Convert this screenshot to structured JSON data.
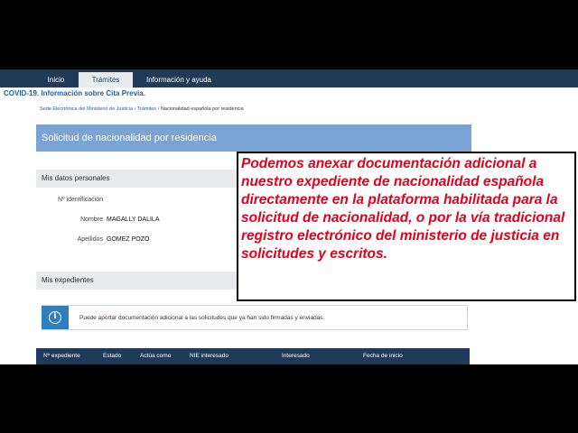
{
  "nav": {
    "items": [
      {
        "label": "Inicio"
      },
      {
        "label": "Trámites"
      },
      {
        "label": "Información y ayuda"
      }
    ]
  },
  "covid_banner": "COVID-19. Información sobre Cita Previa.",
  "breadcrumb": {
    "root": "Sede Electrónica del Ministerio de Justicia",
    "sep": "›",
    "tramites": "Trámites",
    "current": "Nacionalidad española por residencia"
  },
  "page_title": "Solicitud de nacionalidad por residencia",
  "personal": {
    "header": "Mis datos personales",
    "id_label": "Nº identificación",
    "id_value": "",
    "name_label": "Nombre",
    "name_value": "MAGALLY DALILA",
    "surname_label": "Apellidos",
    "surname_value": "GOMEZ POZO"
  },
  "expedientes": {
    "header": "Mis expedientes",
    "info_text": "Puede aportar documentación adicional a las solicitudes que ya han sido firmadas y enviadas.",
    "columns": [
      "Nº expediente",
      "Estado",
      "Actúa como",
      "NIE interesado",
      "Interesado",
      "Fecha de inicio"
    ]
  },
  "overlay": {
    "text": "Podemos anexar documentación adicional a nuestro expediente de nacionalidad española directamente en la plataforma habilitada para la solicitud de nacionalidad, o por la vía tradicional registro electrónico del ministerio de justicia en solicitudes y escritos."
  },
  "colors": {
    "nav_bg": "#1f3b58",
    "title_bar": "#7aa4d4",
    "overlay_text": "#e4001b",
    "info_icon_bg": "#2e7fc1"
  }
}
